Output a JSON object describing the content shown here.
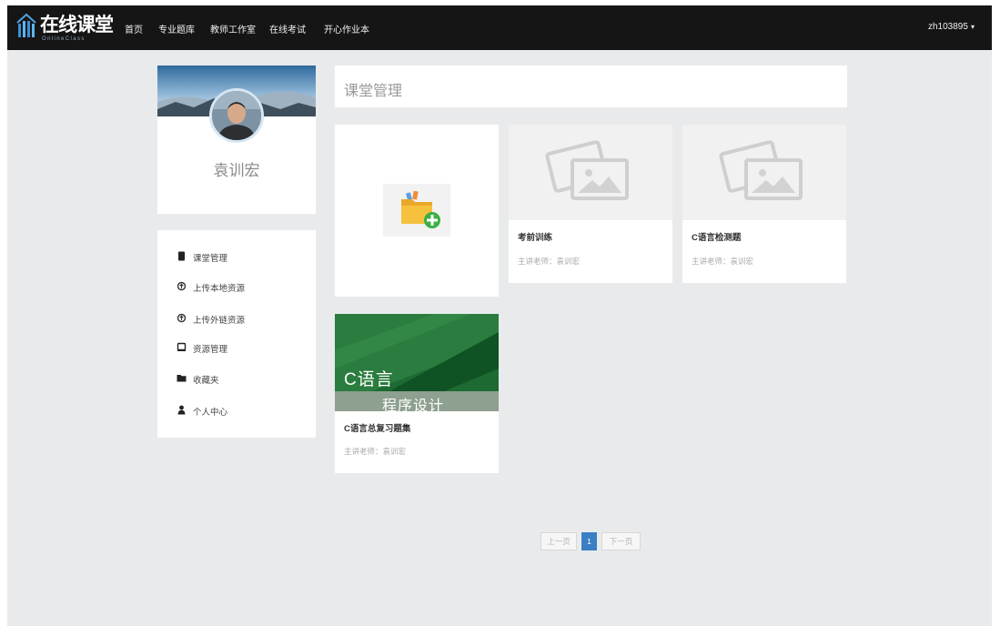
{
  "app": {
    "logo_title": "在线课堂",
    "logo_subtitle": "OnlineClass"
  },
  "nav": {
    "items": [
      {
        "label": "首页"
      },
      {
        "label": "专业题库"
      },
      {
        "label": "教师工作室"
      },
      {
        "label": "在线考试"
      },
      {
        "label": "开心作业本"
      }
    ],
    "user": "zh103895",
    "user_caret_icon": "chevron-down-icon"
  },
  "profile": {
    "name": "袁训宏"
  },
  "sidebar": {
    "items": [
      {
        "label": "课堂管理",
        "icon": "book-icon"
      },
      {
        "label": "上传本地资源",
        "icon": "upload-icon"
      },
      {
        "label": "上传外链资源",
        "icon": "link-upload-icon"
      },
      {
        "label": "资源管理",
        "icon": "resource-icon"
      },
      {
        "label": "收藏夹",
        "icon": "favorites-icon"
      },
      {
        "label": "个人中心",
        "icon": "user-icon"
      }
    ]
  },
  "main": {
    "title": "课堂管理",
    "add_card_icon": "add-folder-icon",
    "courses": [
      {
        "title": "考前训练",
        "teacher": "主讲老师：袁训宏",
        "cover": "image-placeholder-icon"
      },
      {
        "title": "C语言检测题",
        "teacher": "主讲老师：袁训宏",
        "cover": "image-placeholder-icon"
      },
      {
        "title": "C语言总复习题集",
        "teacher": "主讲老师：袁训宏",
        "cover_line1": "C语言",
        "cover_line2": "程序设计"
      }
    ]
  },
  "pagination": {
    "prev": "上一页",
    "current": "1",
    "next": "下一页"
  },
  "colors": {
    "navbar": "#151515",
    "page_bg": "#e9eaec",
    "accent": "#3a7fc4"
  }
}
